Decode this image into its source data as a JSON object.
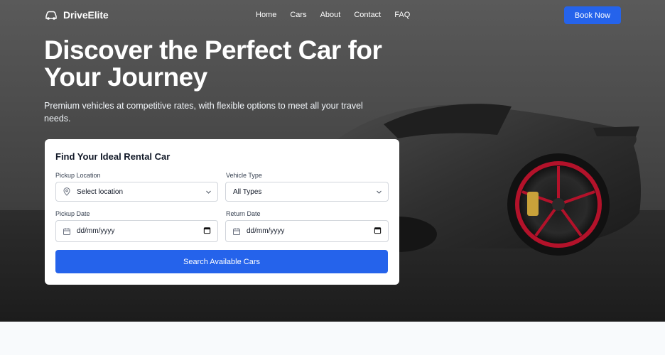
{
  "brand": {
    "name": "DriveElite",
    "logo_icon": "car-icon"
  },
  "nav": {
    "links": [
      "Home",
      "Cars",
      "About",
      "Contact",
      "FAQ"
    ],
    "cta_label": "Book Now"
  },
  "hero": {
    "title": "Discover the Perfect Car for Your Journey",
    "subtitle": "Premium vehicles at competitive rates, with flexible options to meet all your travel needs."
  },
  "search_form": {
    "title": "Find Your Ideal Rental Car",
    "pickup_location": {
      "label": "Pickup Location",
      "value": "Select location",
      "icon": "map-pin-icon"
    },
    "vehicle_type": {
      "label": "Vehicle Type",
      "value": "All Types"
    },
    "pickup_date": {
      "label": "Pickup Date",
      "value": "dd/mm/yyyy",
      "icon": "calendar-icon"
    },
    "return_date": {
      "label": "Return Date",
      "value": "dd/mm/yyyy",
      "icon": "calendar-icon"
    },
    "submit_label": "Search Available Cars"
  },
  "colors": {
    "accent": "#2563eb",
    "hero_dark": "#2b2b2b",
    "wheel_red": "#b3122a"
  }
}
